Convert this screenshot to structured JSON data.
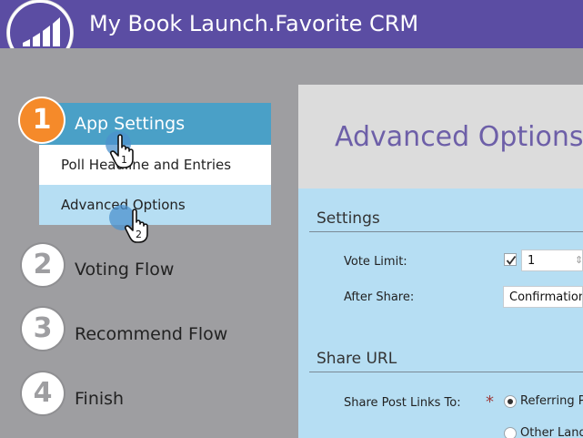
{
  "header": {
    "title": "My Book Launch.Favorite CRM"
  },
  "sidebar": {
    "steps": [
      {
        "number": "1",
        "label": "App Settings",
        "active": true
      },
      {
        "number": "2",
        "label": "Voting Flow"
      },
      {
        "number": "3",
        "label": "Recommend Flow"
      },
      {
        "number": "4",
        "label": "Finish"
      }
    ],
    "sub_items": [
      {
        "label": "Poll Headline and Entries"
      },
      {
        "label": "Advanced Options",
        "selected": true
      }
    ]
  },
  "annotations": {
    "cursor_1": "1",
    "cursor_2": "2"
  },
  "content": {
    "title": "Advanced Options",
    "settings": {
      "section_title": "Settings",
      "vote_limit_label": "Vote Limit:",
      "vote_limit_checked": true,
      "vote_limit_value": "1",
      "after_share_label": "After Share:",
      "after_share_value": "Confirmation"
    },
    "share_url": {
      "section_title": "Share URL",
      "share_post_links_label": "Share Post Links To:",
      "required_mark": "*",
      "options": [
        {
          "label": "Referring P",
          "checked": true
        },
        {
          "label": "Other Land",
          "checked": false
        }
      ]
    }
  },
  "colors": {
    "header": "#5b4da3",
    "active_step": "#4aa0c7",
    "step_badge": "#f58a2a",
    "content_bg": "#b6def3",
    "title": "#6d5fa8"
  }
}
